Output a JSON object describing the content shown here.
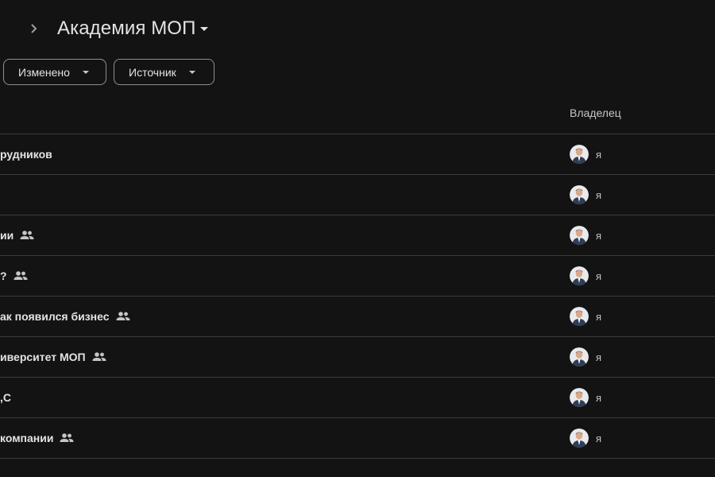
{
  "header": {
    "breadcrumb_icon": "chevron-right-icon",
    "folder_title": "Академия МОП",
    "folder_menu_icon": "caret-down-icon"
  },
  "filters": {
    "modified_label": "Изменено",
    "source_label": "Источник"
  },
  "table": {
    "owner_column": "Владелец",
    "rows": [
      {
        "name": "рудников",
        "shared": false,
        "owner": "я"
      },
      {
        "name": "",
        "shared": false,
        "owner": "я"
      },
      {
        "name": "ии",
        "shared": true,
        "owner": "я"
      },
      {
        "name": "?",
        "shared": true,
        "owner": "я"
      },
      {
        "name": "ак появился бизнес",
        "shared": true,
        "owner": "я"
      },
      {
        "name": "иверситет МОП",
        "shared": true,
        "owner": "я"
      },
      {
        "name": ",С",
        "shared": false,
        "owner": "я"
      },
      {
        "name": "компании",
        "shared": true,
        "owner": "я"
      }
    ]
  },
  "colors": {
    "background": "#131313",
    "divider": "#3c3c3c",
    "text": "#e3e3e3"
  }
}
